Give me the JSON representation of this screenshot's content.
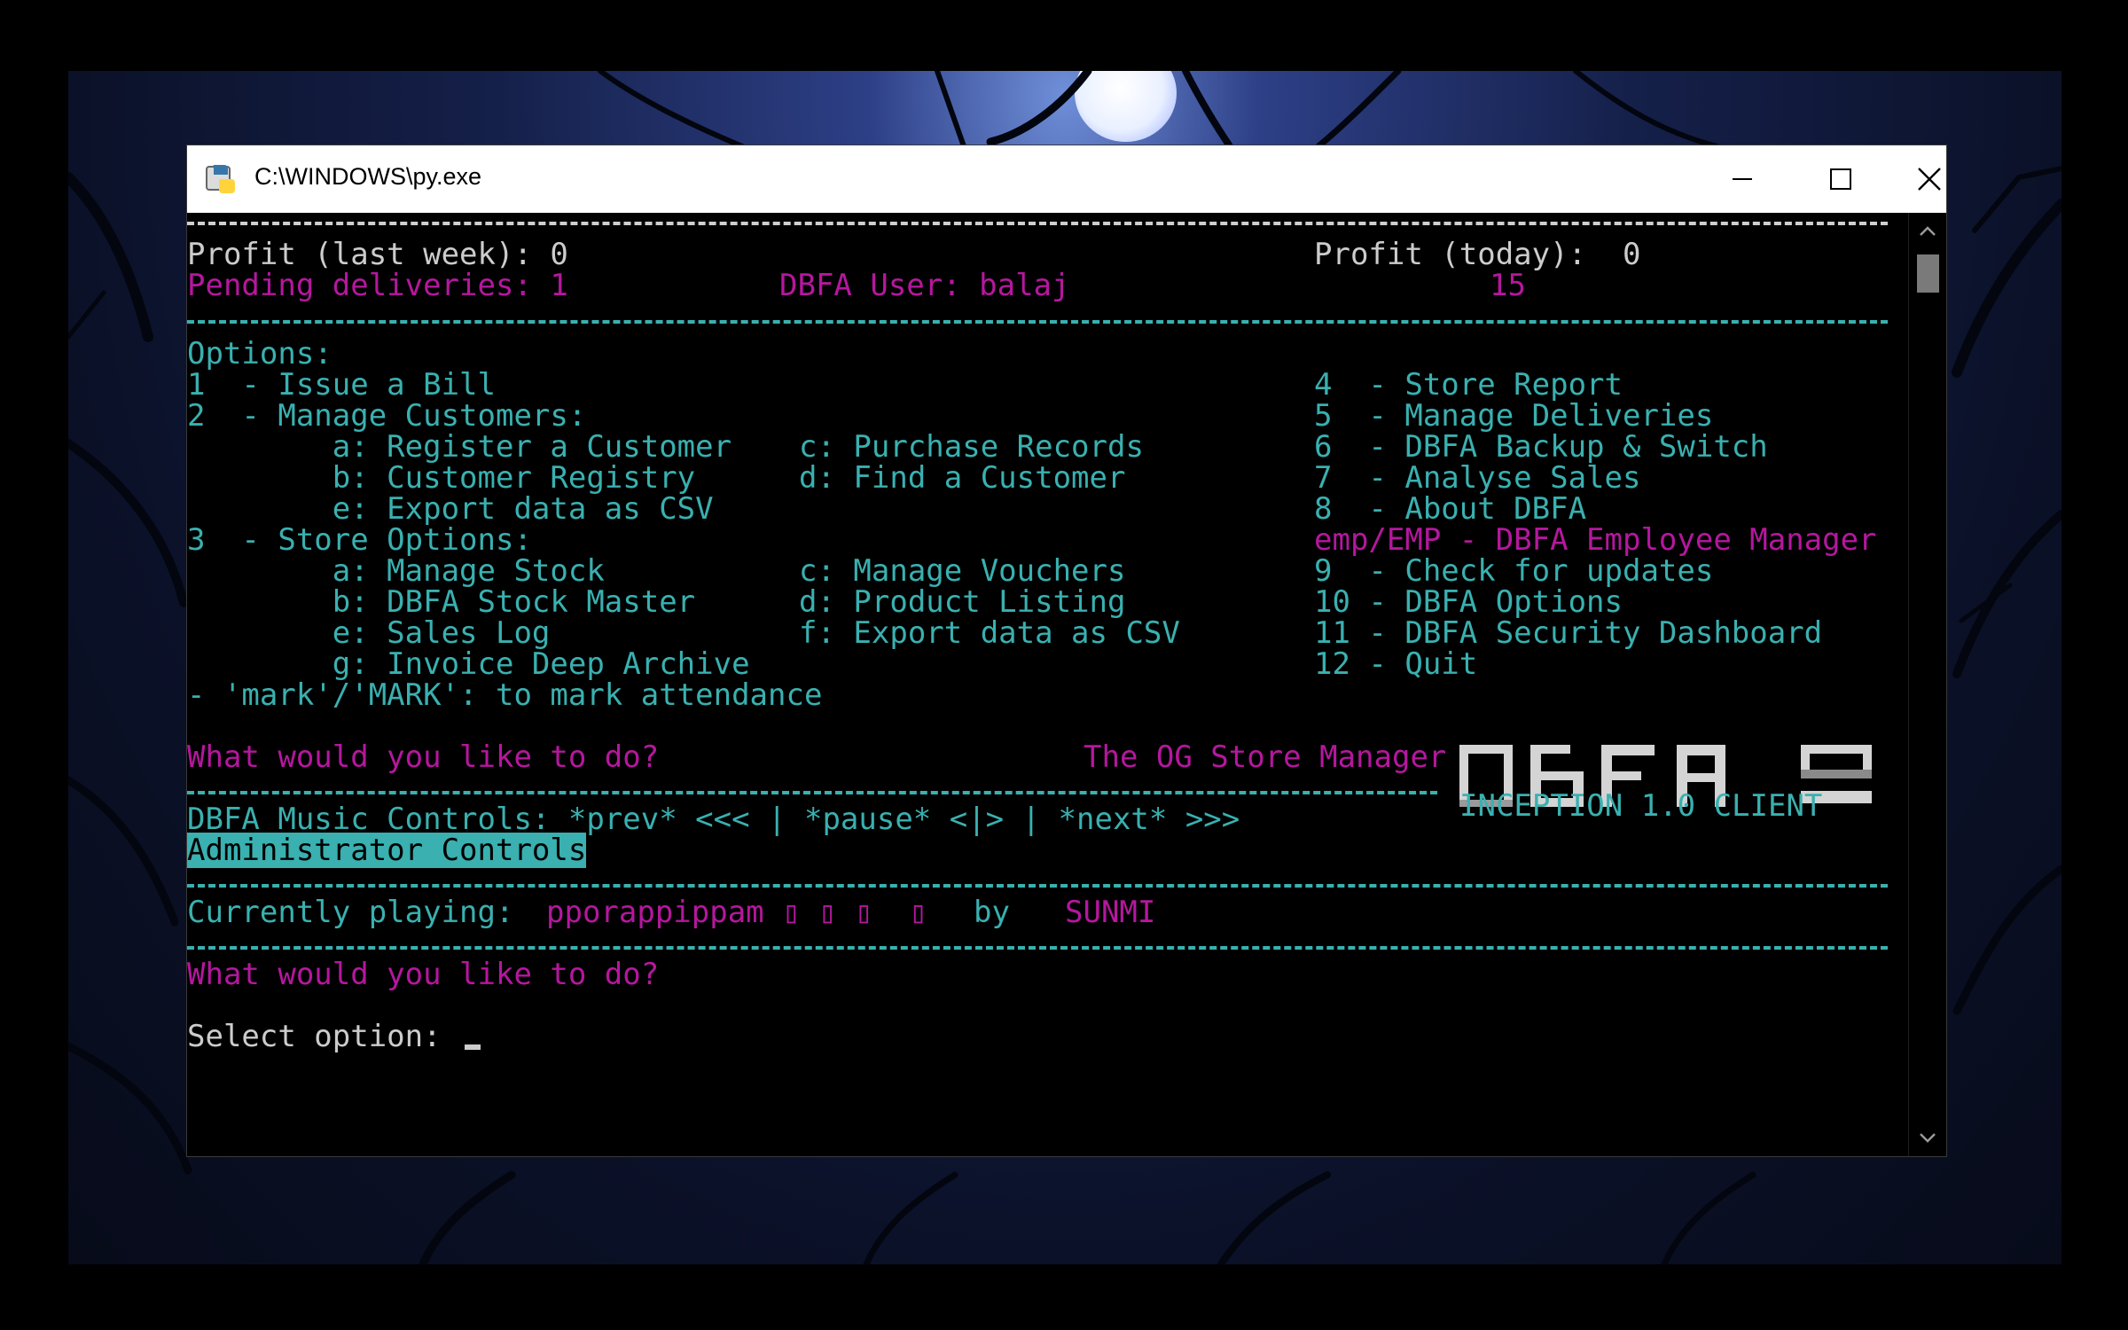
{
  "window": {
    "title": "C:\\WINDOWS\\py.exe"
  },
  "stats": {
    "profit_week": "Profit (last week): 0",
    "profit_today": "Profit (today):  0",
    "pending": "Pending deliveries: 1",
    "user": "DBFA User: balaj",
    "user_num": "15"
  },
  "menu": {
    "header": "Options:",
    "left": [
      "1  - Issue a Bill",
      "2  - Manage Customers:",
      "        a: Register a Customer",
      "        b: Customer Registry",
      "        e: Export data as CSV",
      "3  - Store Options:",
      "        a: Manage Stock",
      "        b: DBFA Stock Master",
      "        e: Sales Log",
      "        g: Invoice Deep Archive",
      "- 'mark'/'MARK': to mark attendance"
    ],
    "mid": [
      "c: Purchase Records",
      "d: Find a Customer",
      "c: Manage Vouchers",
      "d: Product Listing",
      "f: Export data as CSV"
    ],
    "right": [
      "4  - Store Report",
      "5  - Manage Deliveries",
      "6  - DBFA Backup & Switch",
      "7  - Analyse Sales",
      "8  - About DBFA",
      "emp/EMP - DBFA Employee Manager",
      "9  - Check for updates",
      "10 - DBFA Options",
      "11 - DBFA Security Dashboard",
      "12 - Quit"
    ]
  },
  "prompt1": "What would you like to do?",
  "store_tag": "The OG Store Manager",
  "logo": {
    "text": "DBFA",
    "client": "INCEPTION 1.0 CLIENT"
  },
  "music": {
    "controls": "DBFA Music Controls: *prev* <<< | *pause* <|> | *next* >>>",
    "admin": "Administrator Controls",
    "playing_label": "Currently playing:",
    "track": "pporappippam ▯ ▯ ▯  ▯",
    "by": "by",
    "artist": "SUNMI"
  },
  "prompt2": "What would you like to do?",
  "input": {
    "label": "Select option:",
    "value": ""
  },
  "colors": {
    "cyan": "#3ab0b0",
    "magenta": "#b5179e",
    "text": "#cccccc",
    "titlebar": "#ffffff"
  }
}
